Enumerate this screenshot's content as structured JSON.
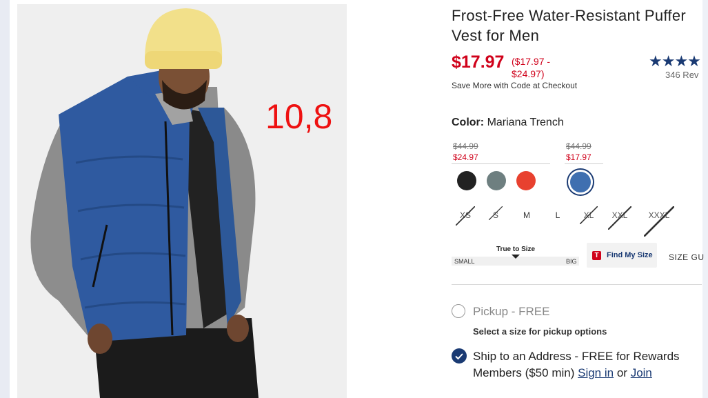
{
  "overlay": {
    "number": "10,8"
  },
  "product": {
    "title": "Frost-Free Water-Resistant Puffer Vest for Men",
    "price": "$17.97",
    "price_range": "($17.97 - $24.97)",
    "promo": "Save More with Code at Checkout",
    "stars": "★★★★",
    "reviews": "346 Rev"
  },
  "color": {
    "label": "Color:",
    "value": "Mariana Trench",
    "groups": [
      {
        "old_price": "$44.99",
        "new_price": "$24.97"
      },
      {
        "old_price": "$44.99",
        "new_price": "$17.97"
      }
    ],
    "swatches": [
      {
        "name": "black",
        "color": "#222222"
      },
      {
        "name": "slate-grey",
        "color": "#6e7f80"
      },
      {
        "name": "red",
        "color": "#e8412f"
      },
      {
        "name": "mariana-trench",
        "color": "#3f6fb0"
      }
    ]
  },
  "sizes": [
    {
      "label": "XS",
      "available": false
    },
    {
      "label": "S",
      "available": false
    },
    {
      "label": "M",
      "available": true
    },
    {
      "label": "L",
      "available": true
    },
    {
      "label": "XL",
      "available": false
    },
    {
      "label": "XXL",
      "available": false
    },
    {
      "label": "XXXL",
      "available": false
    }
  ],
  "fit": {
    "label": "True to Size",
    "small": "SMALL",
    "big": "BIG"
  },
  "find_size": {
    "badge": "T",
    "label": "Find My Size"
  },
  "size_guide": "SIZE GU",
  "fulfillment": {
    "pickup_label": "Pickup - FREE",
    "pickup_sub": "Select a size for pickup options",
    "ship_text": "Ship to an Address - FREE for Rewards Members ($50 min)",
    "sign_in": "Sign in",
    "or": "or",
    "join": "Join"
  }
}
